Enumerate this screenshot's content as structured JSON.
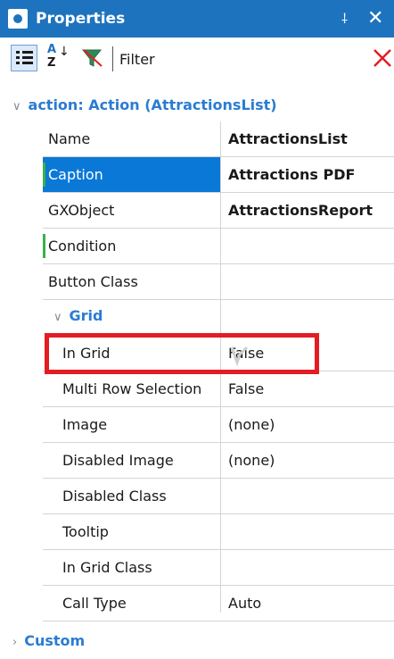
{
  "panel": {
    "title": "Properties",
    "pin_glyph": "⸸",
    "close_glyph": "✕",
    "title_icon": "properties-icon"
  },
  "toolbar": {
    "categorized_icon": "categorized-view-icon",
    "sort_icon": "alphabetical-sort-icon",
    "sort_glyph_a": "A",
    "sort_glyph_z": "Z",
    "filter_icon": "funnel-filter-icon",
    "filter_label": "Filter",
    "filter_value": "",
    "clear_icon": "clear-filter-icon"
  },
  "header_category": {
    "chevron": "∨",
    "label": "action: Action (AttractionsList)"
  },
  "properties": [
    {
      "name": "Name",
      "value": "AttractionsList"
    },
    {
      "name": "Caption",
      "value": "Attractions PDF"
    },
    {
      "name": "GXObject",
      "value": "AttractionsReport"
    },
    {
      "name": "Condition",
      "value": ""
    },
    {
      "name": "Button Class",
      "value": ""
    }
  ],
  "grid_category": {
    "chevron": "∨",
    "label": "Grid"
  },
  "grid_properties": [
    {
      "name": "In Grid",
      "value": "False"
    },
    {
      "name": "Multi Row Selection",
      "value": "False"
    },
    {
      "name": "Image",
      "value": "(none)"
    },
    {
      "name": "Disabled Image",
      "value": "(none)"
    },
    {
      "name": "Disabled Class",
      "value": ""
    },
    {
      "name": "Tooltip",
      "value": ""
    },
    {
      "name": "In Grid Class",
      "value": ""
    },
    {
      "name": "Call Type",
      "value": "Auto"
    }
  ],
  "custom_category": {
    "chevron": "›",
    "label": "Custom"
  },
  "colors": {
    "title_bar": "#1e73be",
    "category_text": "#2a7cd3",
    "selected_row": "#0a78d7",
    "highlight_border": "#e31c23",
    "modified_marker": "#3cb04a"
  }
}
